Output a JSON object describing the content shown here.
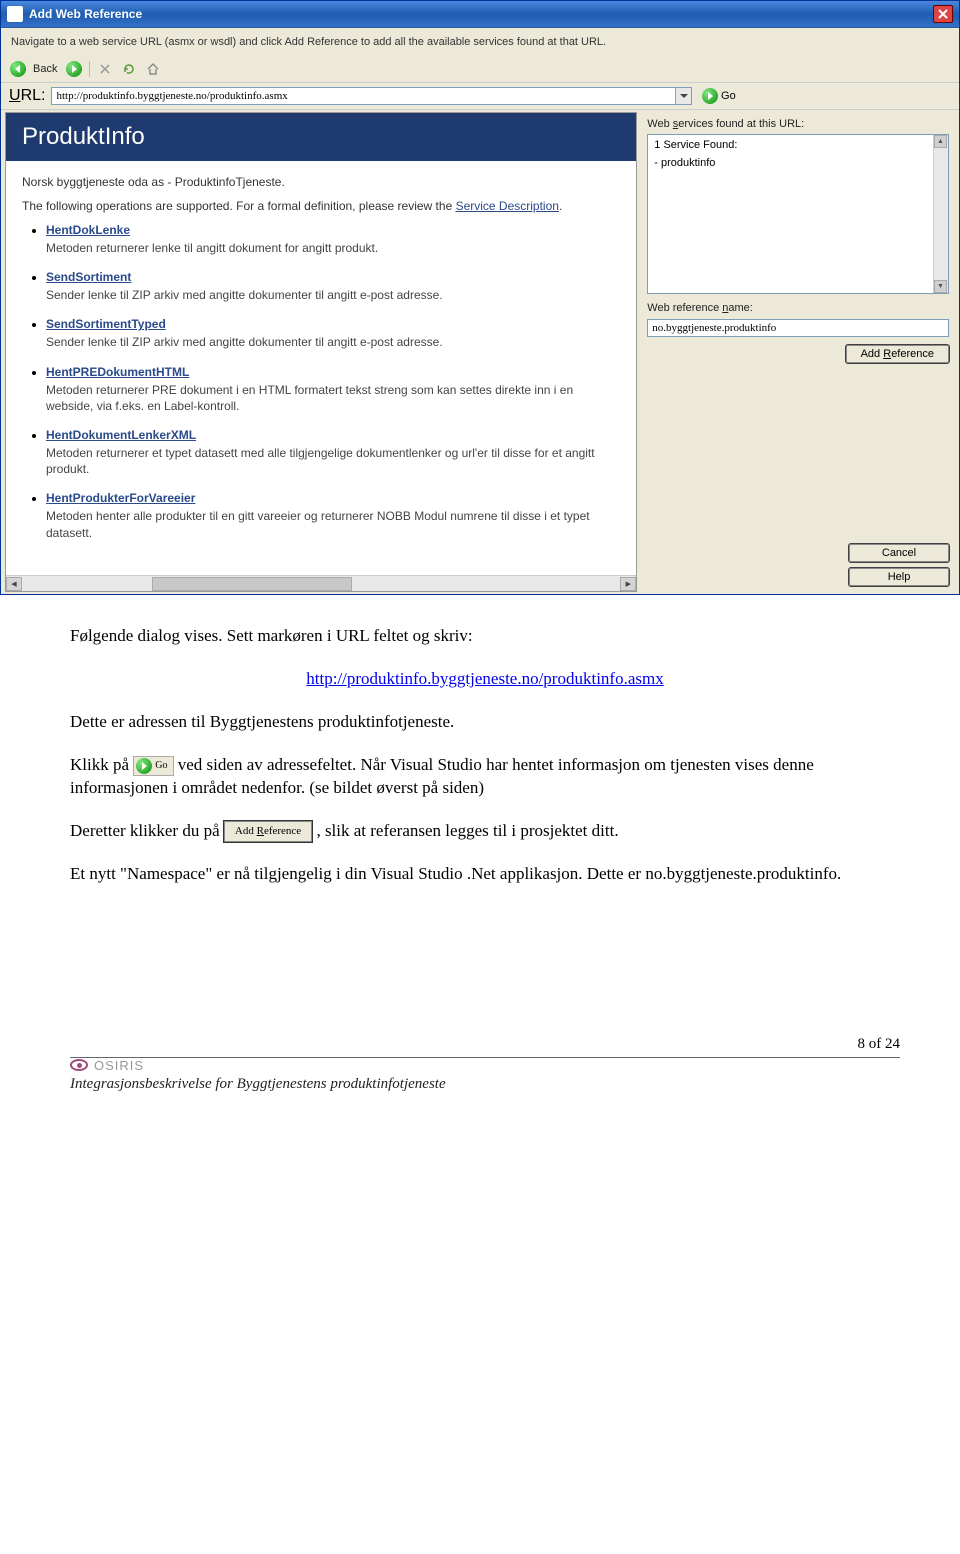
{
  "dialog": {
    "title": "Add Web Reference",
    "instruction": "Navigate to a web service URL (asmx or wsdl) and click Add Reference to add all the available services found at that URL.",
    "back_label": "Back",
    "url_label": "URL:",
    "url_value": "http://produktinfo.byggtjeneste.no/produktinfo.asmx",
    "go_label": "Go"
  },
  "service": {
    "header": "ProduktInfo",
    "provider": "Norsk byggtjeneste oda as - ProduktinfoTjeneste.",
    "sub_prefix": "The following operations are supported. For a formal definition, please review the ",
    "sub_link": "Service Description",
    "sub_suffix": ".",
    "operations": [
      {
        "name": "HentDokLenke",
        "desc": "Metoden returnerer lenke til angitt dokument for angitt produkt."
      },
      {
        "name": "SendSortiment",
        "desc": "Sender lenke til ZIP arkiv med angitte dokumenter til angitt e-post adresse."
      },
      {
        "name": "SendSortimentTyped",
        "desc": "Sender lenke til ZIP arkiv med angitte dokumenter til angitt e-post adresse."
      },
      {
        "name": "HentPREDokumentHTML",
        "desc": "Metoden returnerer PRE dokument i en HTML formatert tekst streng som kan settes direkte inn i en webside, via f.eks. en Label-kontroll."
      },
      {
        "name": "HentDokumentLenkerXML",
        "desc": "Metoden returnerer et typet datasett med alle tilgjengelige dokumentlenker og url'er til disse for et angitt produkt."
      },
      {
        "name": "HentProdukterForVareeier",
        "desc": "Metoden henter alle produkter til en gitt vareeier og returnerer NOBB Modul numrene til disse i et typet datasett."
      }
    ]
  },
  "right": {
    "services_label_pre": "Web ",
    "services_label_u": "s",
    "services_label_post": "ervices found at this URL:",
    "services_found": "1 Service Found:",
    "service_name": "- produktinfo",
    "ref_label_pre": "Web reference ",
    "ref_label_u": "n",
    "ref_label_post": "ame:",
    "ref_value": "no.byggtjeneste.produktinfo",
    "add_ref_pre": "Add ",
    "add_ref_u": "R",
    "add_ref_post": "eference",
    "cancel": "Cancel",
    "help": "Help"
  },
  "doc": {
    "p1": "Følgende dialog vises. Sett markøren i URL feltet og skriv:",
    "url_link": "http://produktinfo.byggtjeneste.no/produktinfo.asmx",
    "p2": "Dette er adressen til Byggtjenestens produktinfotjeneste.",
    "p3a": "Klikk på ",
    "p3b": " ved siden av adressefeltet. Når Visual Studio har hentet informasjon om tjenesten vises denne informasjonen i området nedenfor. (se bildet øverst på siden)",
    "p4a": "Deretter klikker du på ",
    "p4b": " , slik at referansen legges til i prosjektet ditt.",
    "p5a": "Et nytt \"Namespace\" er nå tilgjengelig i din Visual Studio .Net applikasjon. Dette er ",
    "p5b": "no.byggtjeneste.produktinfo.",
    "inline_go": "Go",
    "inline_addref_pre": "Add ",
    "inline_addref_u": "R",
    "inline_addref_post": "eference"
  },
  "footer": {
    "page": "8 of 24",
    "brand": "OSIRIS",
    "title": "Integrasjonsbeskrivelse for Byggtjenestens produktinfotjeneste"
  }
}
